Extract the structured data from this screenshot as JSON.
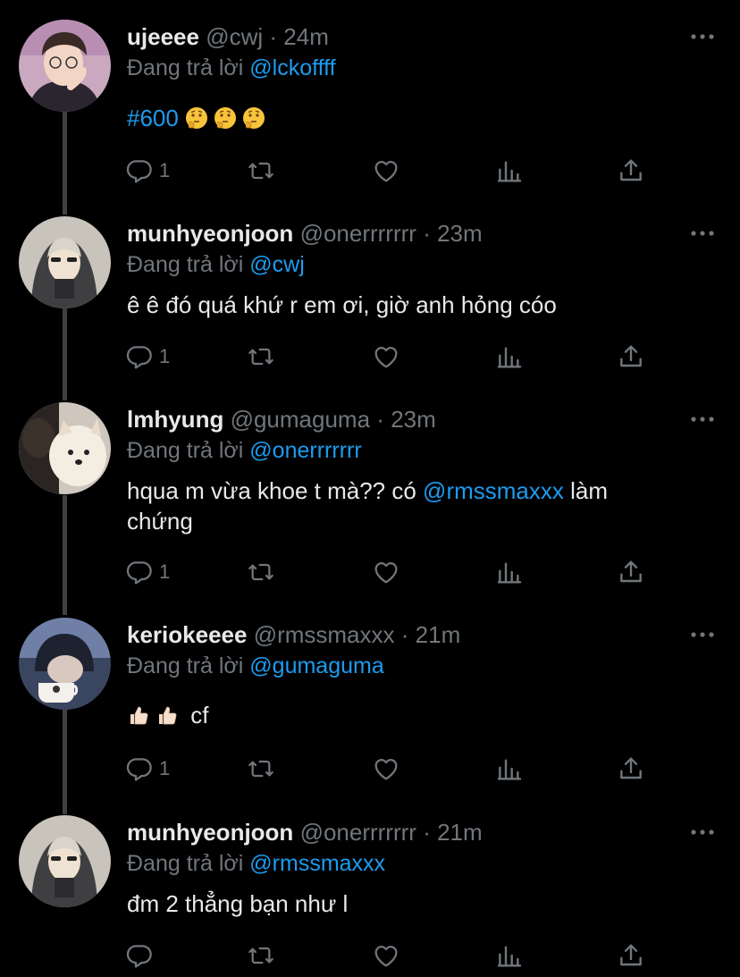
{
  "colors": {
    "background": "#000000",
    "text": "#e7e9ea",
    "muted": "#71767b",
    "link": "#1d9bf0",
    "thread_line": "#3d4145"
  },
  "tweets": [
    {
      "name": "ujeeee",
      "handle": "@cwj",
      "sep": "·",
      "time": "24m",
      "reply_prefix": "Đang trả lời",
      "reply_to": "@lckoffff",
      "hashtag": "#600",
      "emojis": [
        "thinking-face",
        "thinking-face",
        "thinking-face"
      ],
      "reply_count": "1",
      "avatar": "person-with-glasses"
    },
    {
      "name": "munhyeonjoon",
      "handle": "@onerrrrrrr",
      "sep": "·",
      "time": "23m",
      "reply_prefix": "Đang trả lời",
      "reply_to": "@cwj",
      "text": "ê ê đó quá khứ r em ơi, giờ anh hỏng cóo",
      "reply_count": "1",
      "avatar": "person-in-hood"
    },
    {
      "name": "lmhyung",
      "handle": "@gumaguma",
      "sep": "·",
      "time": "23m",
      "reply_prefix": "Đang trả lời",
      "reply_to": "@onerrrrrrr",
      "text_before": "hqua m vừa khoe t mà?? có",
      "mention": "@rmssmaxxx",
      "text_after": "làm",
      "text_line2": "chứng",
      "reply_count": "1",
      "avatar": "pomeranian-dog"
    },
    {
      "name": "keriokeeee",
      "handle": "@rmssmaxxx",
      "sep": "·",
      "time": "21m",
      "reply_prefix": "Đang trả lời",
      "reply_to": "@gumaguma",
      "emojis": [
        "thumbs-up",
        "thumbs-up"
      ],
      "text": "cf",
      "reply_count": "1",
      "avatar": "person-with-cup"
    },
    {
      "name": "munhyeonjoon",
      "handle": "@onerrrrrrr",
      "sep": "·",
      "time": "21m",
      "reply_prefix": "Đang trả lời",
      "reply_to": "@rmssmaxxx",
      "text": "đm 2 thẳng bạn như l",
      "reply_count": "",
      "avatar": "person-in-hood"
    }
  ],
  "icons": {
    "reply": "reply-icon",
    "retweet": "retweet-icon",
    "like": "heart-icon",
    "views": "views-icon",
    "share": "share-icon",
    "more": "more-icon"
  }
}
